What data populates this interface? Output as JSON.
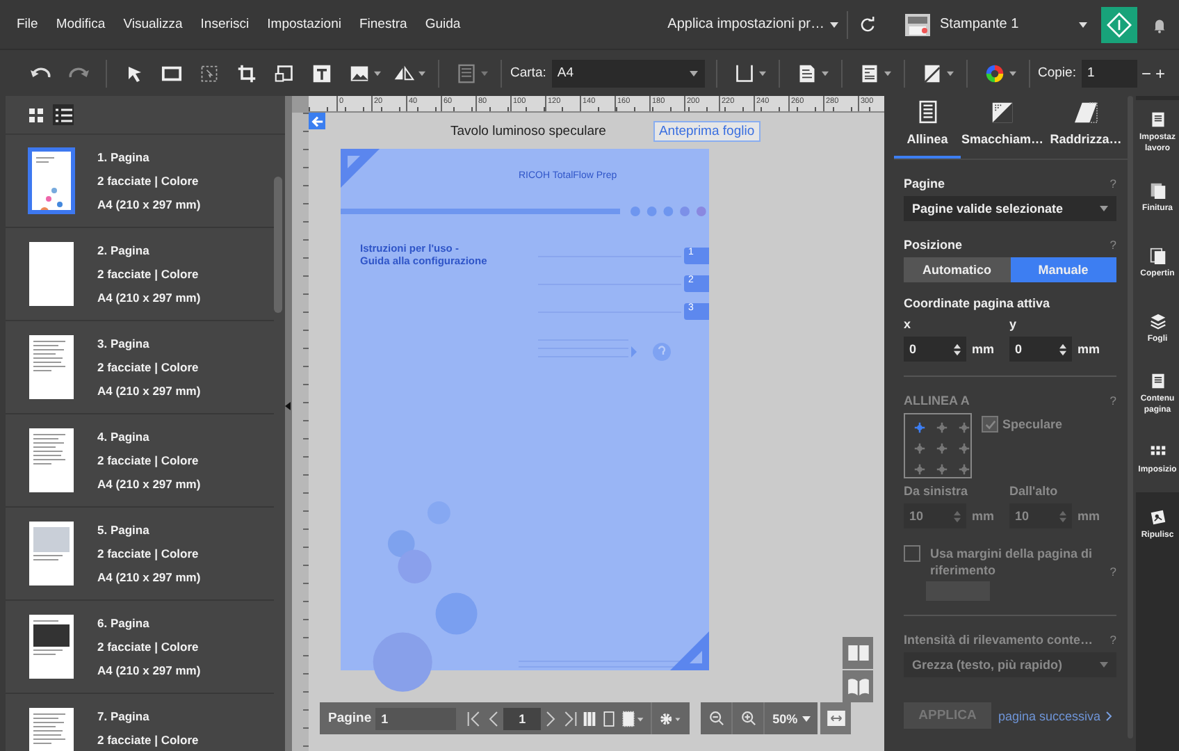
{
  "menu": [
    "File",
    "Modifica",
    "Visualizza",
    "Inserisci",
    "Impostazioni",
    "Finestra",
    "Guida"
  ],
  "topbar": {
    "preset": "Applica impostazioni pr…",
    "printer": "Stampante 1"
  },
  "toolbar": {
    "paper_label": "Carta:",
    "paper": "A4",
    "copies_label": "Copie:",
    "copies": "1",
    "minus": "−",
    "plus": "+"
  },
  "view_modes": [
    {
      "kind": "grid",
      "selected": false
    },
    {
      "kind": "list",
      "selected": true
    }
  ],
  "pages": [
    {
      "title": "1. Pagina",
      "sides": "2 facciate | Colore",
      "size": "A4 (210 x 297 mm)",
      "kind": "cover",
      "selected": true
    },
    {
      "title": "2. Pagina",
      "sides": "2 facciate | Colore",
      "size": "A4 (210 x 297 mm)",
      "kind": "blank",
      "selected": false
    },
    {
      "title": "3. Pagina",
      "sides": "2 facciate | Colore",
      "size": "A4 (210 x 297 mm)",
      "kind": "text",
      "selected": false
    },
    {
      "title": "4. Pagina",
      "sides": "2 facciate | Colore",
      "size": "A4 (210 x 297 mm)",
      "kind": "text",
      "selected": false
    },
    {
      "title": "5. Pagina",
      "sides": "2 facciate | Colore",
      "size": "A4 (210 x 297 mm)",
      "kind": "screenshot",
      "selected": false
    },
    {
      "title": "6. Pagina",
      "sides": "2 facciate | Colore",
      "size": "A4 (210 x 297 mm)",
      "kind": "table",
      "selected": false
    },
    {
      "title": "7. Pagina",
      "sides": "2 facciate | Colore",
      "kind": "text",
      "selected": false
    }
  ],
  "canvas": {
    "title": "Tavolo luminoso speculare",
    "preview_button": "Anteprima foglio",
    "ruler_labels": [
      "0",
      "20",
      "40",
      "60",
      "80",
      "100",
      "120",
      "140",
      "160",
      "180",
      "200",
      "220",
      "240",
      "260",
      "280",
      "300"
    ]
  },
  "document": {
    "brand": "RICOH TotalFlow Prep",
    "heading": [
      "Istruzioni per l'uso -",
      "Guida alla configurazione"
    ],
    "chapters": [
      "1",
      "2",
      "3"
    ]
  },
  "page_nav": {
    "label": "Pagine",
    "pages": "1",
    "current": "1",
    "zoom": "50%"
  },
  "panel_tabs": [
    {
      "label": "Allinea",
      "kind": "align",
      "selected": true
    },
    {
      "label": "Smacchiam…",
      "kind": "despeckle",
      "selected": false
    },
    {
      "label": "Raddrizza…",
      "kind": "deskew",
      "selected": false
    }
  ],
  "panel": {
    "help": "?",
    "pages_label": "Pagine",
    "pages_select": "Pagine valide selezionate",
    "position_label": "Posizione",
    "position_options": [
      {
        "label": "Automatico",
        "selected": false
      },
      {
        "label": "Manuale",
        "selected": true
      }
    ],
    "coords_title": "Coordinate pagina attiva",
    "x_label": "x",
    "y_label": "y",
    "x_value": "0",
    "y_value": "0",
    "x_unit": "mm",
    "y_unit": "mm"
  },
  "align_section": {
    "title": "ALLINEA A",
    "disabled": true,
    "anchors": [
      {
        "selected": true
      },
      {
        "selected": false
      },
      {
        "selected": false
      },
      {
        "selected": false
      },
      {
        "selected": false
      },
      {
        "selected": false
      },
      {
        "selected": false
      },
      {
        "selected": false
      },
      {
        "selected": false
      }
    ],
    "mirror": {
      "label": "Speculare",
      "checked": true
    },
    "left_label": "Da sinistra",
    "top_label": "Dall'alto",
    "left_value": "10",
    "top_value": "10",
    "left_unit": "mm",
    "top_unit": "mm",
    "ref_margins": {
      "label": "Usa margini della pagina di riferimento",
      "checked": false
    }
  },
  "detection": {
    "label": "Intensità di rilevamento conte…",
    "select": "Grezza (testo, più rapido)",
    "disabled": true
  },
  "apply": {
    "label": "APPLICA",
    "disabled": true
  },
  "next_link": "pagina successiva",
  "side_tabs": [
    {
      "lines": [
        "Impostaz",
        "lavoro"
      ],
      "kind": "job",
      "selected": false
    },
    {
      "lines": [
        "Finitura"
      ],
      "kind": "finish",
      "selected": false
    },
    {
      "lines": [
        "Copertin"
      ],
      "kind": "cover",
      "selected": false
    },
    {
      "lines": [
        "Fogli"
      ],
      "kind": "sheets",
      "selected": false
    },
    {
      "lines": [
        "Contenu",
        "pagina"
      ],
      "kind": "content",
      "selected": false
    },
    {
      "lines": [
        "Imposizio"
      ],
      "kind": "impose",
      "selected": false
    },
    {
      "lines": [
        "Ripulisc"
      ],
      "kind": "clean",
      "selected": true
    }
  ]
}
